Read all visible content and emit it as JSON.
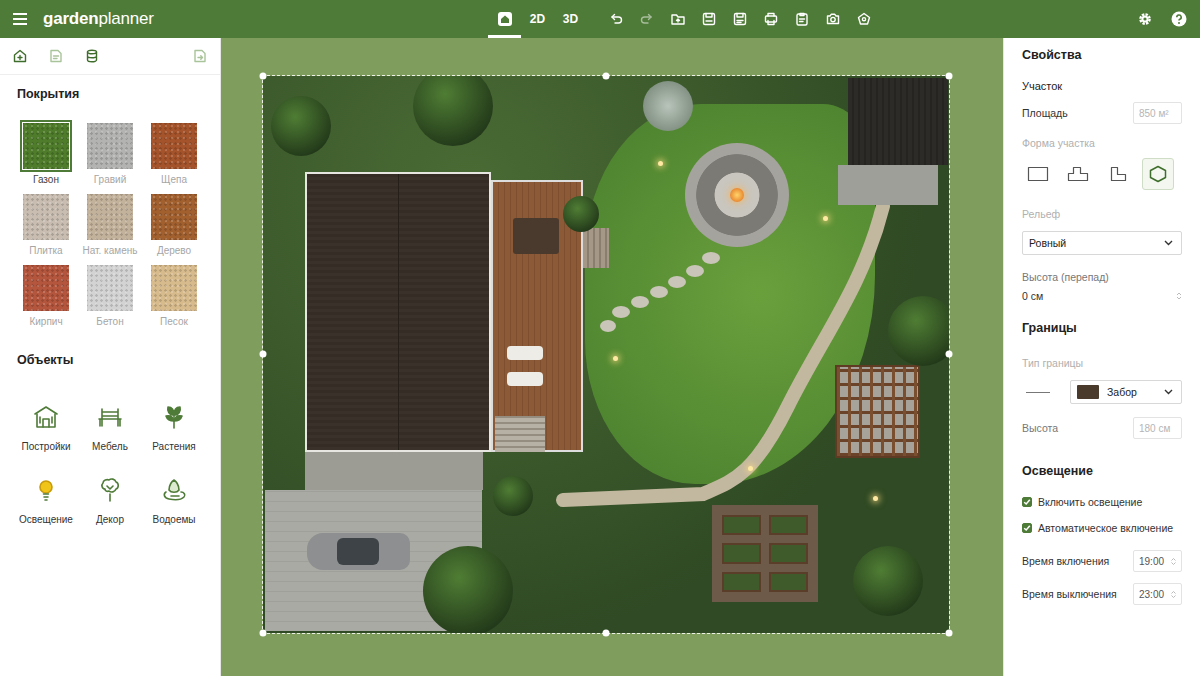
{
  "header": {
    "logo": {
      "bold": "garden",
      "light": "planner"
    },
    "view_tabs": [
      {
        "kind": "home",
        "selected": true
      },
      {
        "kind": "text",
        "label": "2D",
        "selected": false
      },
      {
        "kind": "text",
        "label": "3D",
        "selected": false
      }
    ],
    "tools": [
      {
        "kind": "undo",
        "disabled": false
      },
      {
        "kind": "redo",
        "disabled": true
      },
      {
        "kind": "open",
        "disabled": false
      },
      {
        "kind": "save",
        "disabled": false
      },
      {
        "kind": "save-as",
        "disabled": false
      },
      {
        "kind": "print",
        "disabled": false
      },
      {
        "kind": "clipboard",
        "disabled": false
      },
      {
        "kind": "camera",
        "disabled": false
      },
      {
        "kind": "share",
        "disabled": false
      }
    ],
    "actions": [
      {
        "kind": "settings"
      },
      {
        "kind": "help"
      }
    ]
  },
  "left_panel": {
    "tabs": [
      {
        "kind": "house-plus",
        "disabled": false
      },
      {
        "kind": "layers",
        "disabled": true
      },
      {
        "kind": "stack",
        "disabled": false
      },
      {
        "kind": "export",
        "disabled": true
      }
    ],
    "coverings": {
      "title": "Покрытия",
      "items": [
        {
          "label": "Газон",
          "selected": true,
          "color": "#4e7c2a"
        },
        {
          "label": "Гравий",
          "selected": false,
          "color": "#b3b3b1"
        },
        {
          "label": "Щепа",
          "selected": false,
          "color": "#a5532a"
        },
        {
          "label": "Плитка",
          "selected": false,
          "color": "#c8bdb0"
        },
        {
          "label": "Нат. камень",
          "selected": false,
          "color": "#c3b29b"
        },
        {
          "label": "Дерево",
          "selected": false,
          "color": "#a2602f"
        },
        {
          "label": "Кирпич",
          "selected": false,
          "color": "#b4553d"
        },
        {
          "label": "Бетон",
          "selected": false,
          "color": "#d3d3d3"
        },
        {
          "label": "Песок",
          "selected": false,
          "color": "#d7bb8d"
        }
      ]
    },
    "objects": {
      "title": "Объекты",
      "items": [
        {
          "label": "Постройки",
          "kind": "building"
        },
        {
          "label": "Мебель",
          "kind": "furniture"
        },
        {
          "label": "Растения",
          "kind": "plant"
        },
        {
          "label": "Освещение",
          "kind": "light"
        },
        {
          "label": "Декор",
          "kind": "decor"
        },
        {
          "label": "Водоемы",
          "kind": "pond"
        }
      ]
    }
  },
  "properties": {
    "title": "Свойства",
    "plot": {
      "title": "Участок",
      "area": {
        "label": "Площадь",
        "value": "850 м²",
        "disabled": true
      },
      "shape": {
        "label": "Форма участка",
        "options": [
          {
            "kind": "rect",
            "selected": false
          },
          {
            "kind": "l-shape",
            "selected": false
          },
          {
            "kind": "l-shape-mirror",
            "selected": false
          },
          {
            "kind": "polygon",
            "selected": true
          }
        ]
      },
      "relief": {
        "label": "Рельеф",
        "value": "Ровный"
      },
      "height": {
        "label": "Высота (перепад)",
        "value": "0 см"
      }
    },
    "borders": {
      "title": "Границы",
      "type": {
        "label": "Тип границы",
        "value": "Забор"
      },
      "height": {
        "label": "Высота",
        "value": "180 см",
        "disabled": true
      }
    },
    "lighting": {
      "title": "Освещение",
      "checks": [
        {
          "label": "Включить освещение",
          "checked": true
        },
        {
          "label": "Автоматическое включение",
          "checked": true
        }
      ],
      "times": [
        {
          "label": "Время включения",
          "value": "19:00"
        },
        {
          "label": "Время выключения",
          "value": "23:00"
        }
      ]
    }
  }
}
